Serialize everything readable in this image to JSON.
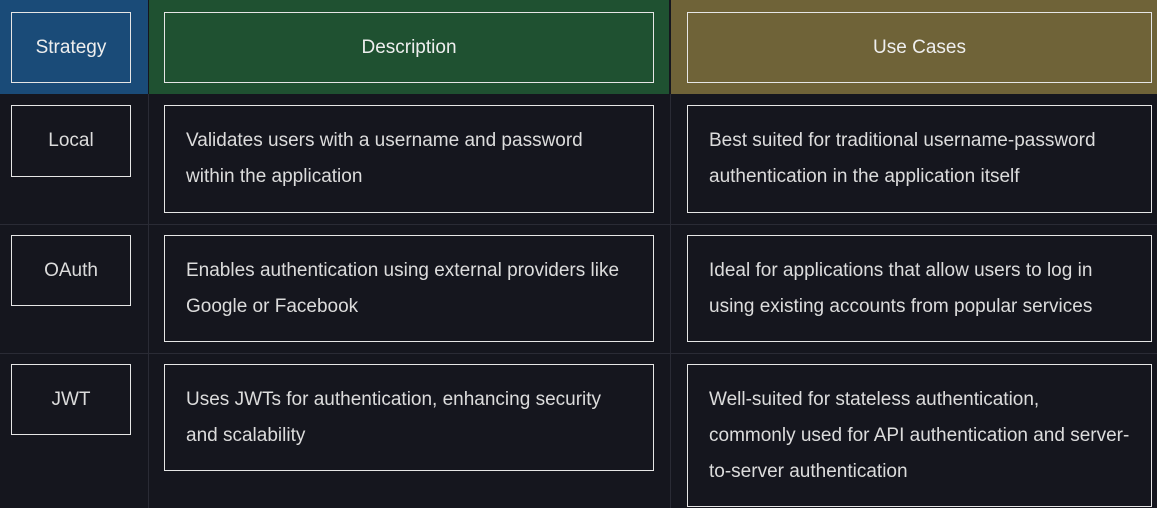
{
  "headers": {
    "strategy": "Strategy",
    "description": "Description",
    "use_cases": "Use Cases"
  },
  "rows": [
    {
      "strategy": "Local",
      "description": "Validates users with a username and password within the application",
      "use_cases": "Best suited for traditional username-password authentication in the application itself"
    },
    {
      "strategy": "OAuth",
      "description": "Enables authentication using external providers like Google or Facebook",
      "use_cases": "Ideal for applications that allow users to log in using existing accounts from popular services"
    },
    {
      "strategy": "JWT",
      "description": "Uses JWTs for authentication, enhancing security and scalability",
      "use_cases": "Well-suited for stateless authentication, commonly used for API authentication and server-to-server authentication"
    }
  ],
  "colors": {
    "background": "#15161e",
    "strategy_header": "#1a4b78",
    "description_header": "#1f5131",
    "use_cases_header": "#6f6338",
    "border": "#e6e6e6"
  }
}
